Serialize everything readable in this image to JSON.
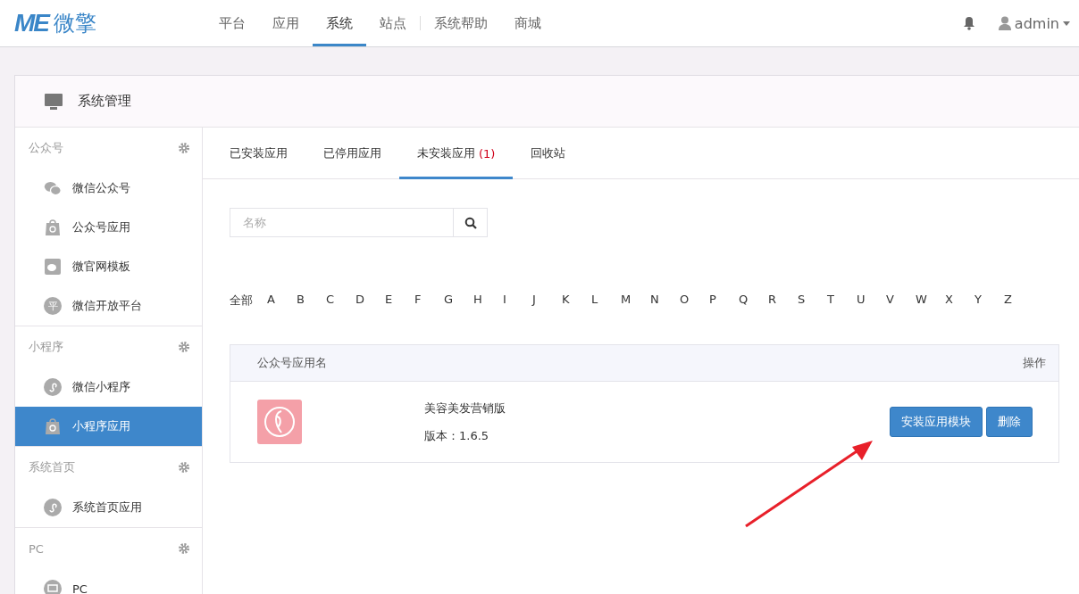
{
  "brand": {
    "mark": "ME",
    "name": "微擎"
  },
  "nav": [
    {
      "label": "平台",
      "selected": false
    },
    {
      "label": "应用",
      "selected": false
    },
    {
      "label": "系统",
      "selected": true
    },
    {
      "label": "站点",
      "selected": false
    },
    {
      "label": "系统帮助",
      "selected": false
    },
    {
      "label": "商城",
      "selected": false
    }
  ],
  "user": {
    "name": "admin"
  },
  "panel": {
    "title": "系统管理"
  },
  "sidebar": {
    "groups": [
      {
        "title": "公众号",
        "items": [
          {
            "label": "微信公众号",
            "kind": "wechat",
            "selected": false
          },
          {
            "label": "公众号应用",
            "kind": "bag",
            "selected": false
          },
          {
            "label": "微官网模板",
            "kind": "template",
            "selected": false
          },
          {
            "label": "微信开放平台",
            "kind": "glyph",
            "glyph": "平",
            "selected": false
          }
        ]
      },
      {
        "title": "小程序",
        "items": [
          {
            "label": "微信小程序",
            "kind": "mini",
            "selected": false
          },
          {
            "label": "小程序应用",
            "kind": "bag",
            "selected": true
          }
        ]
      },
      {
        "title": "系统首页",
        "items": [
          {
            "label": "系统首页应用",
            "kind": "mini",
            "selected": false
          }
        ]
      },
      {
        "title": "PC",
        "items": [
          {
            "label": "PC",
            "kind": "pc",
            "selected": false
          }
        ]
      }
    ]
  },
  "tabs": [
    {
      "label": "已安装应用",
      "selected": false
    },
    {
      "label": "已停用应用",
      "selected": false
    },
    {
      "label": "未安装应用",
      "count": "(1)",
      "selected": true
    },
    {
      "label": "回收站",
      "selected": false
    }
  ],
  "search": {
    "placeholder": "名称"
  },
  "letters": [
    "全部",
    "A",
    "B",
    "C",
    "D",
    "E",
    "F",
    "G",
    "H",
    "I",
    "J",
    "K",
    "L",
    "M",
    "N",
    "O",
    "P",
    "Q",
    "R",
    "S",
    "T",
    "U",
    "V",
    "W",
    "X",
    "Y",
    "Z"
  ],
  "table": {
    "columns": [
      "公众号应用名",
      "操作"
    ],
    "rows": [
      {
        "name": "美容美发营销版",
        "version": "版本：1.6.5",
        "buttons": [
          "安装应用模块",
          "删除"
        ]
      }
    ]
  }
}
